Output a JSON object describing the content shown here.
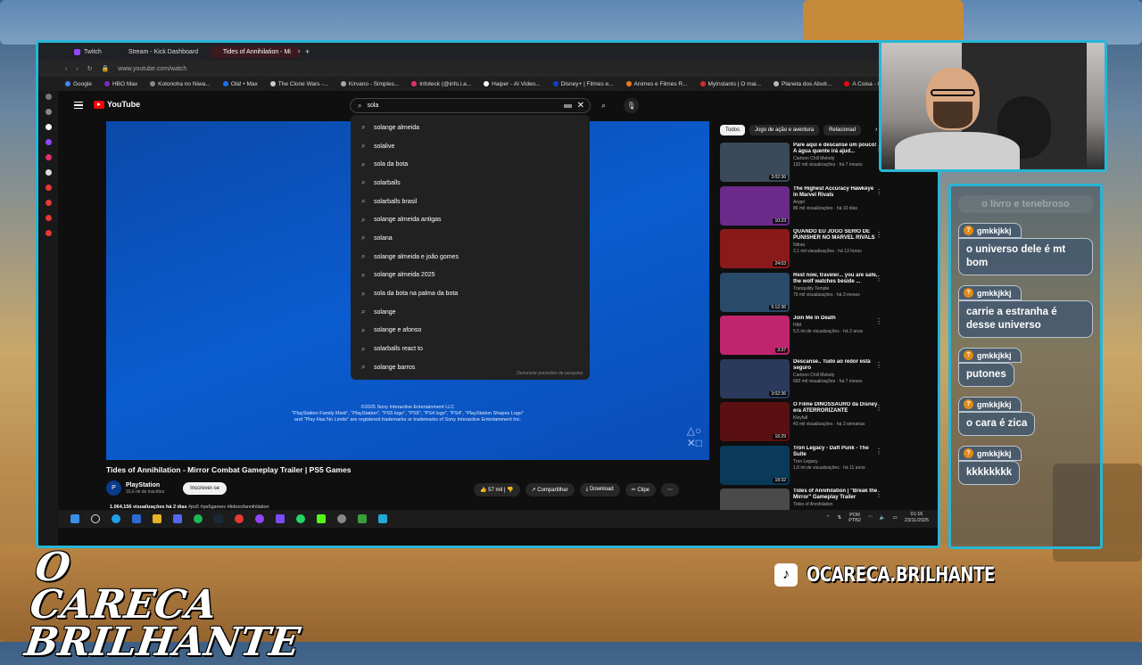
{
  "browser": {
    "tabs": [
      {
        "label": "Twitch",
        "color": "#9146ff",
        "active": false
      },
      {
        "label": "Stream - Kick Dashboard",
        "color": "#53fc18",
        "active": false
      },
      {
        "label": "Tides of Annihilation - Mi",
        "color": "#ff0000",
        "active": true
      }
    ],
    "url": "www.youtube.com/watch",
    "bookmarks": [
      {
        "label": "Google",
        "color": "#4285f4"
      },
      {
        "label": "HBO Max",
        "color": "#7b2cbf"
      },
      {
        "label": "Kotonoha no Niwa...",
        "color": "#888888"
      },
      {
        "label": "Olá! • Max",
        "color": "#1f6feb"
      },
      {
        "label": "The Clone Wars -...",
        "color": "#cccccc"
      },
      {
        "label": "Kirvano - Simples...",
        "color": "#aaaaaa"
      },
      {
        "label": "Infoteck (@info.i.a...",
        "color": "#e1306c"
      },
      {
        "label": "Haiper - AI Video...",
        "color": "#ffffff"
      },
      {
        "label": "Disney+ | Filmes e...",
        "color": "#113ccf"
      },
      {
        "label": "Animes e Filmes R...",
        "color": "#f47521"
      },
      {
        "label": "MyInstants | O mai...",
        "color": "#d32f2f"
      },
      {
        "label": "Planeta dos Abutr...",
        "color": "#bbbbbb"
      },
      {
        "label": "A Coisa - O",
        "color": "#e50914"
      }
    ]
  },
  "youtube": {
    "logo": "YouTube",
    "search": {
      "value": "sola",
      "suggestions": [
        "solange almeida",
        "solalive",
        "sola da bota",
        "solarballs",
        "solarballs brasil",
        "solange almeida antigas",
        "solana",
        "solange almeida e joão gomes",
        "solange almeida 2025",
        "sola da bota na palma da bota",
        "solange",
        "solange e afonso",
        "solarballs react to",
        "solange barros"
      ],
      "report": "Denunciar previsões de pesquisa"
    },
    "player": {
      "copyright_lines": [
        "©2025 Sony Interactive Entertainment LLC",
        "\"PlayStation Family Mark\", \"PlayStation\", \"PS5 logo\", \"PS5\", \"PS4 logo\", \"PS4\", \"PlayStation Shapes Logo\"",
        "and \"Play Has No Limits\" are registered trademarks or trademarks of Sony Interactive Entertainment Inc."
      ]
    },
    "video_title": "Tides of Annihilation - Mirror Combat Gameplay Trailer | PS5 Games",
    "channel": {
      "name": "PlayStation",
      "subs": "16,6 mi de inscritos",
      "subscribe": "Inscrever-se"
    },
    "actions": {
      "likes": "57 mil",
      "share": "Compartilhar",
      "download": "Download",
      "clip": "Clipe"
    },
    "meta": {
      "views": "1.064.156 visualizações",
      "age": "há 2 dias",
      "tags": "#ps5 #ps5games #tidesofannihilation"
    },
    "chips": [
      "Todos",
      "Jogo de ação e aventura",
      "Relacionad"
    ],
    "recommendations": [
      {
        "title": "Pare aqui e descanse um pouco! A água quente irá ajud...",
        "channel": "Cartoon Chill Melody",
        "stats": "192 mil visualizações · há 7 meses",
        "duration": "3:02:36",
        "thumb": "#3a4a5a"
      },
      {
        "title": "The Highest Accuracy Hawkeye in Marvel Rivals",
        "channel": "Angel",
        "stats": "86 mil visualizações · há 10 dias",
        "duration": "10:23",
        "thumb": "#6b2a8a"
      },
      {
        "title": "QUANDO EU JOGO SÉRIO DE PUNISHER NO MARVEL RIVALS",
        "channel": "Nitrao",
        "stats": "2,1 mil visualizações · há 13 horas",
        "duration": "24:03",
        "thumb": "#8a1a1a"
      },
      {
        "title": "Rest now, traveler... you are safe, the wolf watches beside ...",
        "channel": "Tranquility Temple",
        "stats": "79 mil visualizações · há 3 meses",
        "duration": "5:12:36",
        "thumb": "#2a4a6a"
      },
      {
        "title": "Join Me In Death",
        "channel": "HIM",
        "stats": "5,5 mi de visualizações · há 2 anos",
        "duration": "3:37",
        "thumb": "#c0246e"
      },
      {
        "title": "Descanse.. Tudo ao redor está seguro",
        "channel": "Cartoon Chill Melody",
        "stats": "660 mil visualizações · há 7 meses",
        "duration": "3:02:36",
        "thumb": "#2a3a5a"
      },
      {
        "title": "O Filme DINOSSAURO da Disney era ATERRORIZANTE",
        "channel": "Kleyfall",
        "stats": "43 mil visualizações · há 3 semanas",
        "duration": "16:29",
        "thumb": "#5a1010"
      },
      {
        "title": "Tron Legacy - Daft Punk - The Suite",
        "channel": "Tron Legacy",
        "stats": "1,8 mi de visualizações · há 11 anos",
        "duration": "18:32",
        "thumb": "#0a3a5a"
      },
      {
        "title": "Tides of Annihilation | \"Break the Mirror\" Gameplay Trailer",
        "channel": "Tides of Annihilation",
        "stats": "",
        "duration": "",
        "thumb": "#4a4a4a"
      }
    ]
  },
  "taskbar": {
    "lang": "POR",
    "lang2": "PTB2",
    "time": "01:16",
    "date": "23/11/2025"
  },
  "chat": {
    "faded": "o livro e tenebroso",
    "messages": [
      {
        "user": "gmkkjkkj",
        "text": "o universo dele é mt bom"
      },
      {
        "user": "gmkkjkkj",
        "text": "carrie a estranha é desse universo"
      },
      {
        "user": "gmkkjkkj",
        "text": "putones"
      },
      {
        "user": "gmkkjkkj",
        "text": "o cara é zica"
      },
      {
        "user": "gmkkjkkj",
        "text": "kkkkkkkk"
      }
    ]
  },
  "overlay": {
    "logo_line1": "O CARECA",
    "logo_line2": "BRILHANTE",
    "handle": "OCARECA.BRILHANTE"
  }
}
